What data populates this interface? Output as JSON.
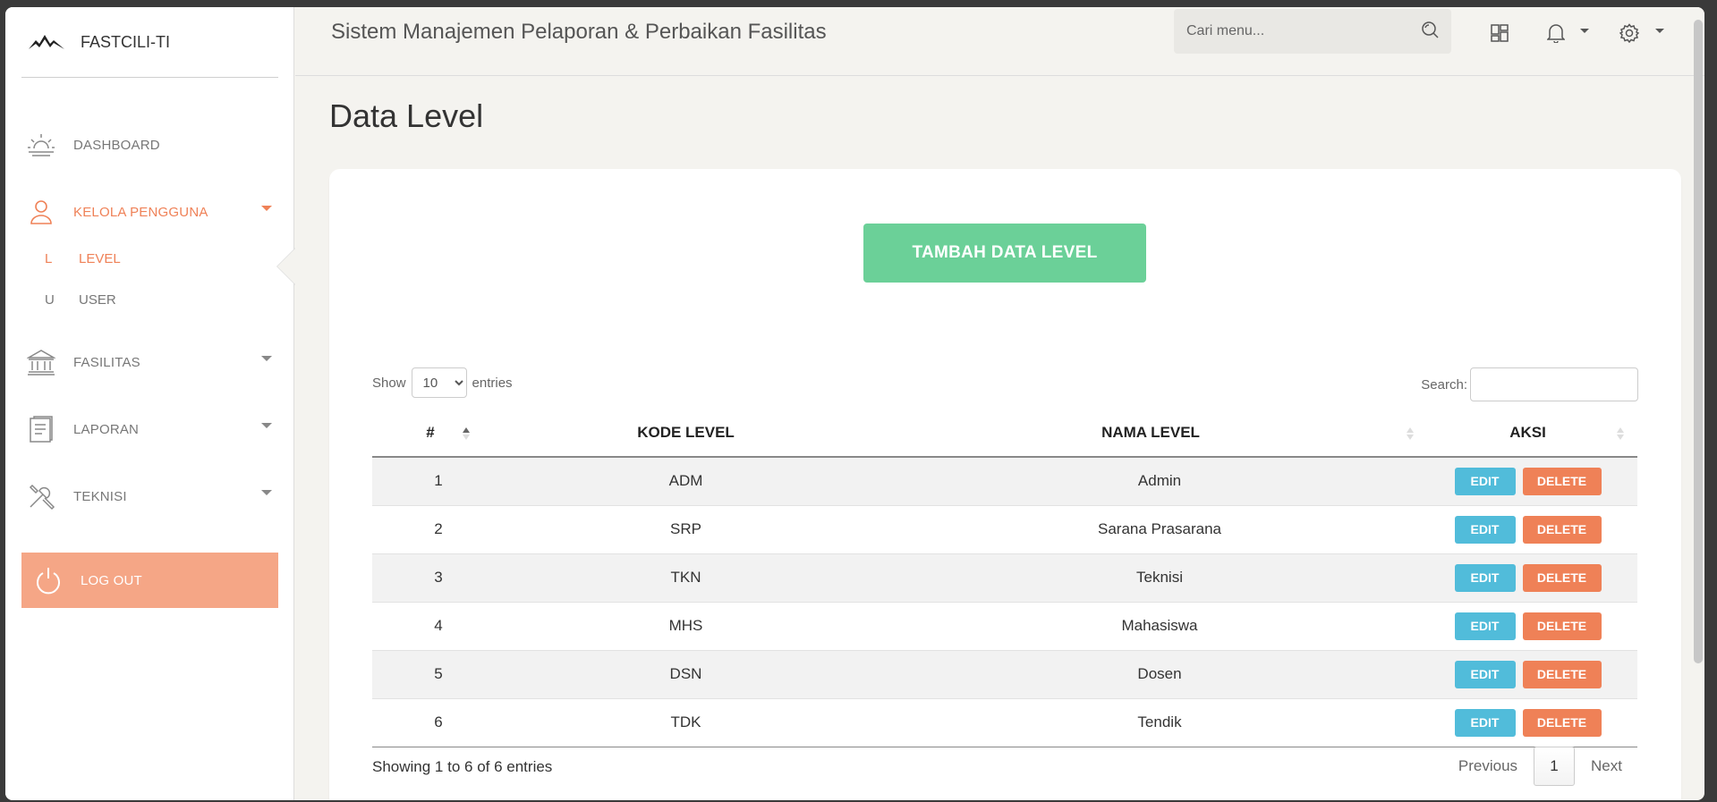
{
  "brand": {
    "name": "FASTCILI-TI",
    "logo_icon": "mountain-logo-icon"
  },
  "sidebar": {
    "items": [
      {
        "key": "dashboard",
        "label": "DASHBOARD",
        "icon": "sunrise-icon"
      },
      {
        "key": "kelola",
        "label": "KELOLA PENGGUNA",
        "icon": "user-icon",
        "active": true
      },
      {
        "key": "fasilitas",
        "label": "FASILITAS",
        "icon": "bank-icon"
      },
      {
        "key": "laporan",
        "label": "LAPORAN",
        "icon": "document-icon"
      },
      {
        "key": "teknisi",
        "label": "TEKNISI",
        "icon": "tools-icon"
      }
    ],
    "sub_items": [
      {
        "mini": "L",
        "label": "LEVEL",
        "active": true
      },
      {
        "mini": "U",
        "label": "USER"
      }
    ],
    "logout_label": "LOG OUT"
  },
  "header": {
    "title": "Sistem Manajemen Pelaporan & Perbaikan Fasilitas",
    "search_placeholder": "Cari menu..."
  },
  "page": {
    "title": "Data Level"
  },
  "actions": {
    "add_label": "TAMBAH DATA LEVEL"
  },
  "datatable": {
    "show_label": "Show",
    "entries_label": "entries",
    "length_value": "10",
    "search_label": "Search:",
    "columns": [
      "#",
      "KODE LEVEL",
      "NAMA LEVEL",
      "AKSI"
    ],
    "rows": [
      {
        "no": "1",
        "kode": "ADM",
        "nama": "Admin"
      },
      {
        "no": "2",
        "kode": "SRP",
        "nama": "Sarana Prasarana"
      },
      {
        "no": "3",
        "kode": "TKN",
        "nama": "Teknisi"
      },
      {
        "no": "4",
        "kode": "MHS",
        "nama": "Mahasiswa"
      },
      {
        "no": "5",
        "kode": "DSN",
        "nama": "Dosen"
      },
      {
        "no": "6",
        "kode": "TDK",
        "nama": "Tendik"
      }
    ],
    "edit_label": "EDIT",
    "delete_label": "DELETE",
    "info": "Showing 1 to 6 of 6 entries",
    "prev_label": "Previous",
    "current_page": "1",
    "next_label": "Next"
  },
  "colors": {
    "accent": "#ef8157",
    "success": "#6bd098",
    "info": "#51bcda",
    "logout_bg": "#f5a686"
  }
}
